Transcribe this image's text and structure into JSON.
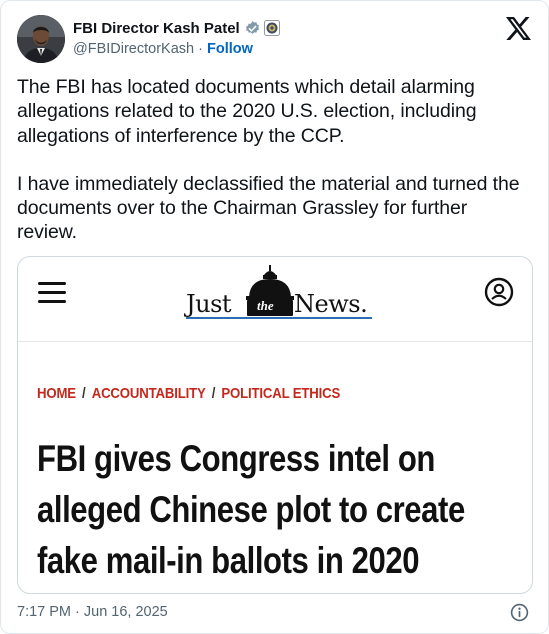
{
  "author": {
    "display_name": "FBI Director Kash Patel",
    "handle": "@FBIDirectorKash",
    "separator": " · ",
    "follow_label": "Follow",
    "verified_icon": "verified-badge-icon",
    "affiliation_icon": "government-seal-icon"
  },
  "tweet": {
    "paragraphs": [
      "The FBI has located documents which detail alarming allegations related to the 2020 U.S. election, including allegations of interference by the CCP.",
      "I have immediately declassified the material and turned the documents over to the Chairman Grassley for further review."
    ],
    "timestamp": "7:17 PM · Jun 16, 2025"
  },
  "card": {
    "brand": {
      "just": "Just",
      "the": "the",
      "news": "News."
    },
    "breadcrumb": [
      "HOME",
      "ACCOUNTABILITY",
      "POLITICAL ETHICS"
    ],
    "breadcrumb_separator": "/",
    "headline": "FBI gives Congress intel on alleged Chinese plot to create fake mail-in ballots in 2020"
  },
  "colors": {
    "follow": "#0066c0",
    "breadcrumb": "#c4281c",
    "secondary_text": "#536471",
    "verified": "#829aab"
  }
}
